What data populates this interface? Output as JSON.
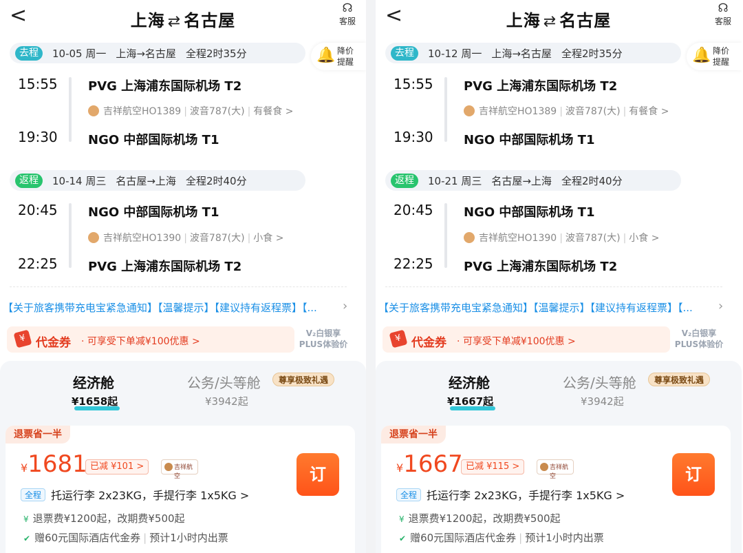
{
  "panels": [
    {
      "header": {
        "back": "<",
        "from": "上海",
        "arrow": "⇄",
        "to": "名古屋",
        "service": "客服"
      },
      "price_alert": "降价提醒",
      "outbound": {
        "tag": "去程",
        "date": "10-05 周一",
        "route": "上海→名古屋",
        "duration": "全程2时35分",
        "dep_time": "15:55",
        "dep_airport": "PVG 上海浦东国际机场 T2",
        "airline": "吉祥航空HO1389",
        "aircraft": "波音787(大)",
        "meal": "有餐食 >",
        "arr_time": "19:30",
        "arr_airport": "NGO 中部国际机场 T1"
      },
      "return": {
        "tag": "返程",
        "date": "10-14 周三",
        "route": "名古屋→上海",
        "duration": "全程2时40分",
        "dep_time": "20:45",
        "dep_airport": "NGO 中部国际机场 T1",
        "airline": "吉祥航空HO1390",
        "aircraft": "波音787(大)",
        "meal": "小食 >",
        "arr_time": "22:25",
        "arr_airport": "PVG 上海浦东国际机场 T2"
      },
      "notice": "【关于旅客携带充电宝紧急通知】【温馨提示】【建议持有返程票】【...",
      "coupon": {
        "title": "代金券",
        "desc": "· 可享受下单减¥100优惠 >"
      },
      "plus": "V₂白银享 PLUS体验价",
      "cabins": {
        "economy": {
          "label": "经济舱",
          "price": "¥1658起"
        },
        "business": {
          "label": "公务/头等舱",
          "price": "¥3942起",
          "badge": "尊享极致礼遇"
        }
      },
      "fare": {
        "refund_tag": "退票省一半",
        "yen": "¥",
        "price": "1681",
        "saved": "已减 ¥101 >",
        "airline_badge": "吉祥航空",
        "book": "订",
        "baggage_tag": "全程",
        "baggage": "托运行李 2x23KG，手提行李 1x5KG >",
        "fees": "退票费¥1200起，改期费¥500起",
        "gift": "赠60元国际酒店代金券",
        "ticketing": "预计1小时内出票"
      }
    },
    {
      "header": {
        "back": "<",
        "from": "上海",
        "arrow": "⇄",
        "to": "名古屋",
        "service": "客服"
      },
      "price_alert": "降价提醒",
      "outbound": {
        "tag": "去程",
        "date": "10-12 周一",
        "route": "上海→名古屋",
        "duration": "全程2时35分",
        "dep_time": "15:55",
        "dep_airport": "PVG 上海浦东国际机场 T2",
        "airline": "吉祥航空HO1389",
        "aircraft": "波音787(大)",
        "meal": "有餐食 >",
        "arr_time": "19:30",
        "arr_airport": "NGO 中部国际机场 T1"
      },
      "return": {
        "tag": "返程",
        "date": "10-21 周三",
        "route": "名古屋→上海",
        "duration": "全程2时40分",
        "dep_time": "20:45",
        "dep_airport": "NGO 中部国际机场 T1",
        "airline": "吉祥航空HO1390",
        "aircraft": "波音787(大)",
        "meal": "小食 >",
        "arr_time": "22:25",
        "arr_airport": "PVG 上海浦东国际机场 T2"
      },
      "notice": "【关于旅客携带充电宝紧急通知】【温馨提示】【建议持有返程票】【...",
      "coupon": {
        "title": "代金券",
        "desc": "· 可享受下单减¥100优惠 >"
      },
      "plus": "V₂白银享 PLUS体验价",
      "cabins": {
        "economy": {
          "label": "经济舱",
          "price": "¥1667起"
        },
        "business": {
          "label": "公务/头等舱",
          "price": "¥3942起",
          "badge": "尊享极致礼遇"
        }
      },
      "fare": {
        "refund_tag": "退票省一半",
        "yen": "¥",
        "price": "1667",
        "saved": "已减 ¥115 >",
        "airline_badge": "吉祥航空",
        "book": "订",
        "baggage_tag": "全程",
        "baggage": "托运行李 2x23KG，手提行李 1x5KG >",
        "fees": "退票费¥1200起，改期费¥500起",
        "gift": "赠60元国际酒店代金券",
        "ticketing": "预计1小时内出票"
      }
    }
  ]
}
